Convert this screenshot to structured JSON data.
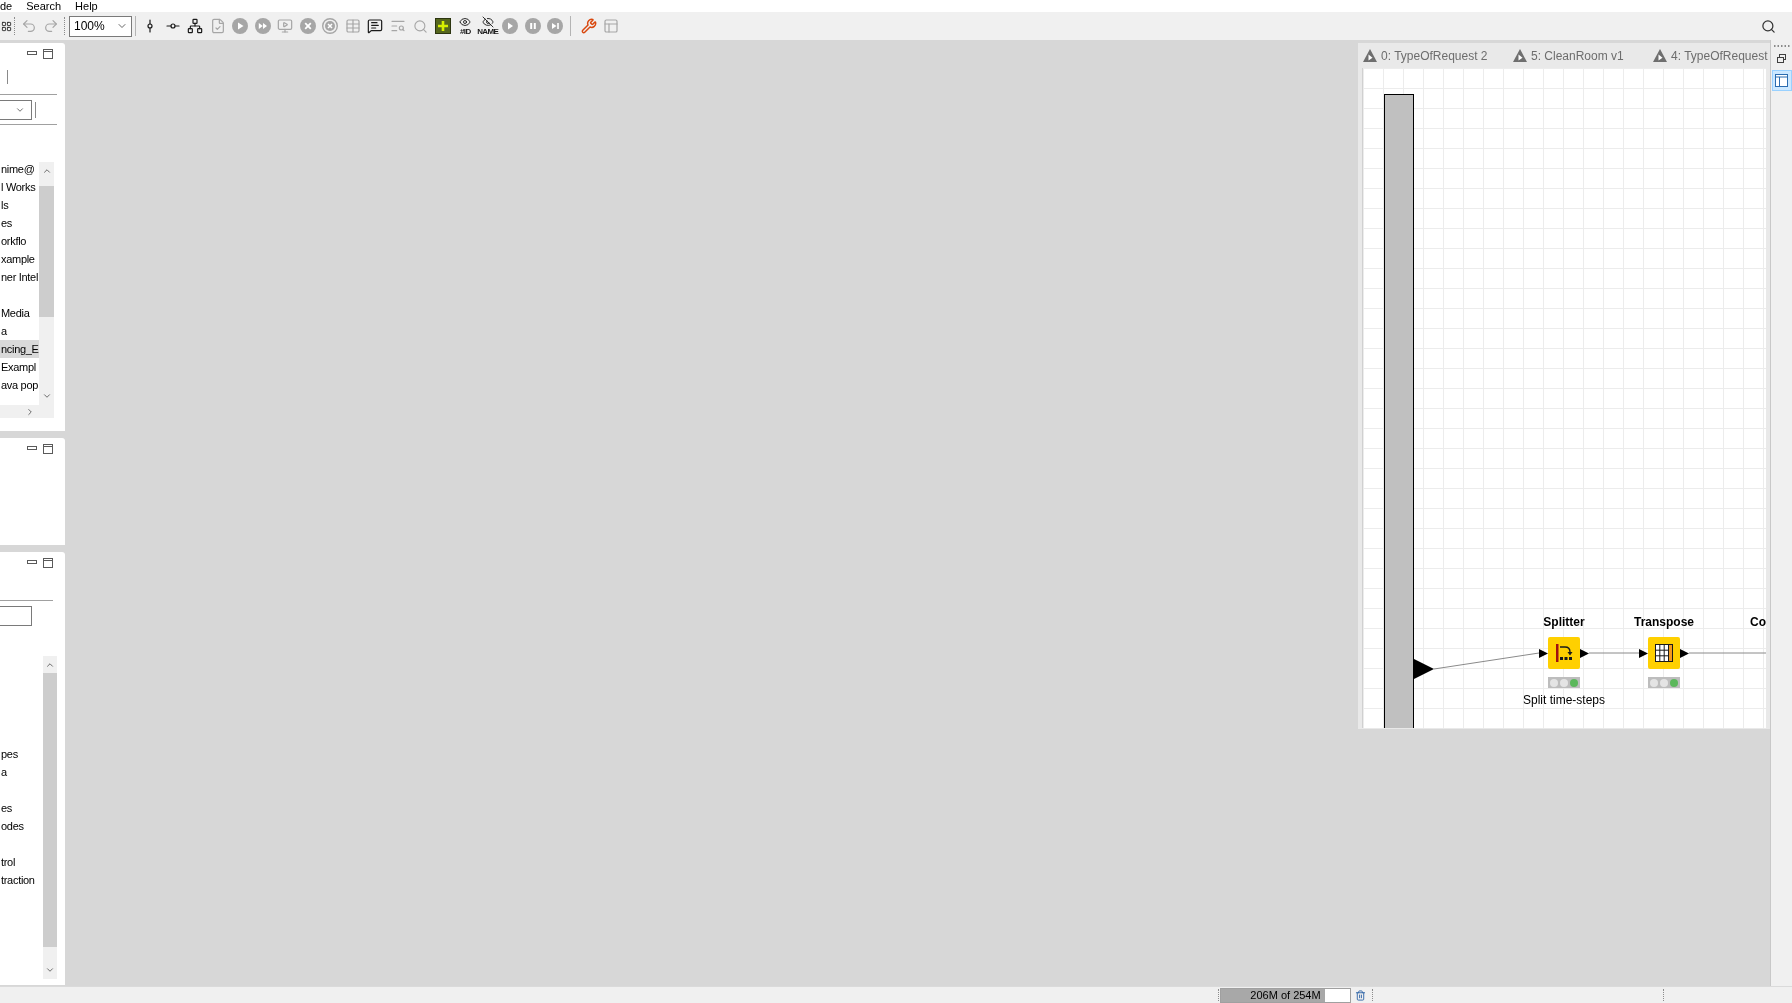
{
  "menu_bar": {
    "items": [
      "de",
      "Search",
      "Help"
    ]
  },
  "toolbar": {
    "left_buttons": [
      {
        "kind": "grid",
        "disabled": false
      },
      {
        "kind": "undo",
        "disabled": true
      },
      {
        "kind": "redo",
        "disabled": true
      }
    ],
    "zoom": {
      "value": "100%"
    },
    "buttons": [
      {
        "kind": "align-vertical",
        "disabled": false
      },
      {
        "kind": "align-horizontal",
        "disabled": false
      },
      {
        "kind": "auto-layout",
        "disabled": false
      },
      {
        "kind": "configure",
        "disabled": true
      },
      {
        "kind": "execute",
        "disabled": true
      },
      {
        "kind": "execute-all",
        "disabled": true
      },
      {
        "kind": "execute-view",
        "disabled": true
      },
      {
        "kind": "cancel",
        "disabled": true
      },
      {
        "kind": "cancel-all",
        "disabled": true
      },
      {
        "kind": "reset",
        "disabled": true
      },
      {
        "kind": "annotation",
        "disabled": false
      },
      {
        "kind": "open-view",
        "disabled": true
      },
      {
        "kind": "zoom",
        "disabled": true
      },
      {
        "kind": "add",
        "disabled": false
      },
      {
        "kind": "show-id",
        "label": "#ID",
        "disabled": false
      },
      {
        "kind": "hide-name",
        "label": "NAME",
        "disabled": false
      },
      {
        "kind": "step-in",
        "disabled": true
      },
      {
        "kind": "pause",
        "disabled": true
      },
      {
        "kind": "step",
        "disabled": true
      }
    ],
    "right_buttons": [
      {
        "kind": "wrench",
        "disabled": false
      },
      {
        "kind": "layout",
        "disabled": true
      }
    ]
  },
  "top_left_panel": {
    "tree": [
      {
        "label": "nime@",
        "selected": false
      },
      {
        "label": "l Works",
        "selected": false
      },
      {
        "label": "ls",
        "selected": false
      },
      {
        "label": "es",
        "selected": false
      },
      {
        "label": "orkflo",
        "selected": false
      },
      {
        "label": "xample",
        "selected": false
      },
      {
        "label": "ner Intel",
        "selected": false
      },
      {
        "label": "Media",
        "selected": false
      },
      {
        "label": "a",
        "selected": false
      },
      {
        "label": "ncing_E",
        "selected": true
      },
      {
        "label": "Exampl",
        "selected": false
      },
      {
        "label": "ava pop",
        "selected": false
      }
    ]
  },
  "bottom_left_panel": {
    "list": [
      {
        "label": "pes"
      },
      {
        "label": "a"
      },
      {
        "label": "es"
      },
      {
        "label": "odes"
      },
      {
        "label": "trol"
      },
      {
        "label": "traction"
      }
    ]
  },
  "editor": {
    "tabs": [
      {
        "label": "0: TypeOfRequest 2",
        "selected": false
      },
      {
        "label": "5: CleanRoom v1",
        "selected": false
      },
      {
        "label": "4: TypeOfRequest",
        "selected": false
      }
    ],
    "nodes": [
      {
        "kind": "splitter",
        "title": "Splitter",
        "annotation": "Split time-steps",
        "executed": true
      },
      {
        "kind": "transpose",
        "title": "Transpose",
        "executed": true
      },
      {
        "title": "Co"
      }
    ]
  },
  "side_bar": {
    "view_button": {
      "selected": true
    }
  },
  "status_bar": {
    "heap": {
      "text": "206M of 254M",
      "level": 0.81
    }
  }
}
